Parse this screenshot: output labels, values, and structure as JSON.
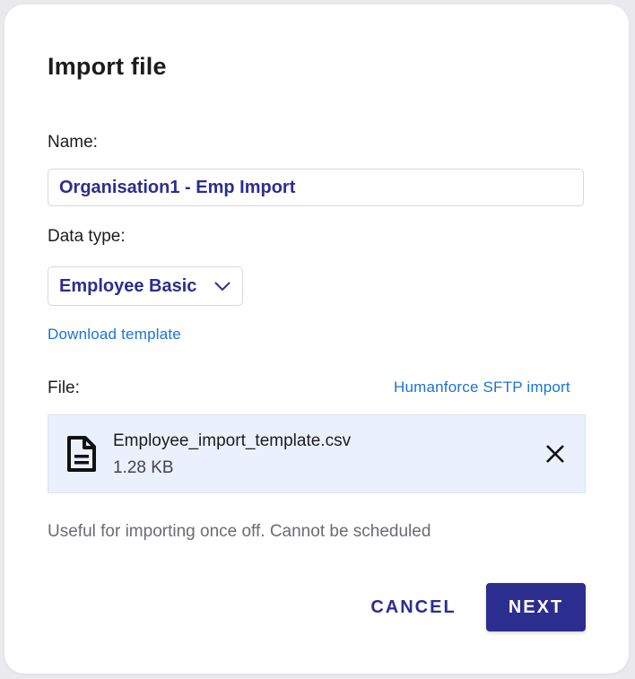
{
  "dialog": {
    "title": "Import file"
  },
  "name_field": {
    "label": "Name:",
    "value": "Organisation1 - Emp Import"
  },
  "data_type": {
    "label": "Data type:",
    "selected": "Employee Basic",
    "icon": "chevron-down-icon"
  },
  "download_template_link": "Download template",
  "file_section": {
    "label": "File:",
    "sftp_link": "Humanforce SFTP import",
    "file": {
      "name": "Employee_import_template.csv",
      "size": "1.28 KB",
      "icon": "document-icon",
      "remove_icon": "close-icon"
    }
  },
  "help_text": "Useful for importing once off. Cannot be scheduled",
  "actions": {
    "cancel_label": "CANCEL",
    "next_label": "NEXT"
  },
  "colors": {
    "primary": "#2b2e8f",
    "link": "#1a73d8",
    "file_box_bg": "#eaf1fd"
  }
}
